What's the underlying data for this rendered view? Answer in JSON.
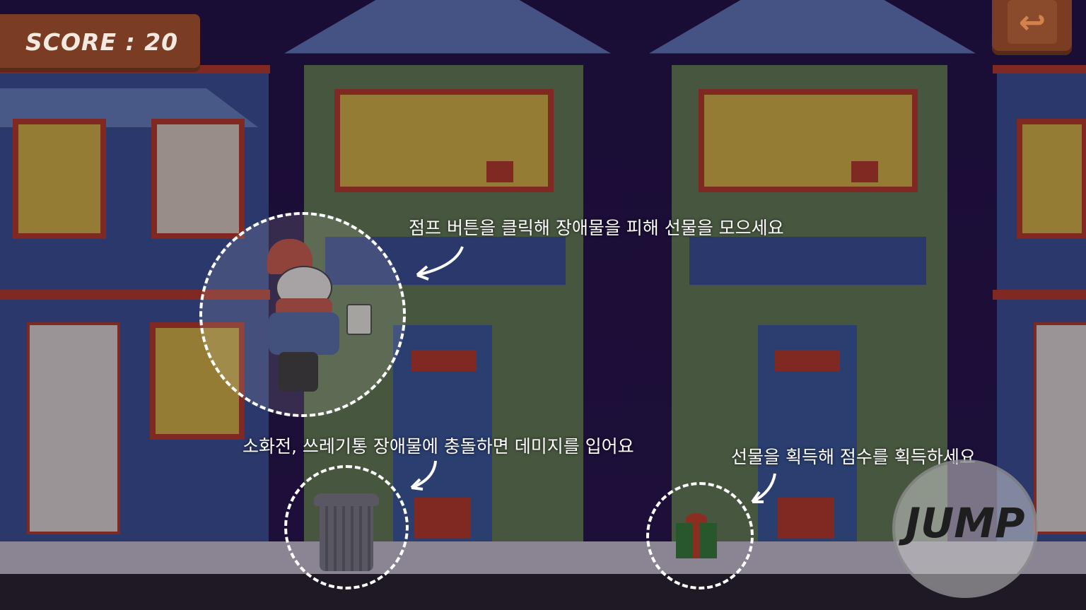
{
  "hud": {
    "score_text": "SCORE : 20",
    "back_icon": "back-arrow-icon",
    "jump_label": "JUMP"
  },
  "hints": {
    "jump": "점프 버튼을 클릭해 장애물을 피해 선물을 모으세요",
    "obstacle": "소화전, 쓰레기통 장애물에 충돌하면 데미지를 입어요",
    "gift": "선물을 획득해 점수를 획득하세요"
  },
  "colors": {
    "sky": "#24124a",
    "blue_house": "#4058a0",
    "green_house": "#6c8a5a",
    "trim": "#c9402a",
    "window_light": "#e8c64a",
    "wood": "#7a3d24"
  }
}
